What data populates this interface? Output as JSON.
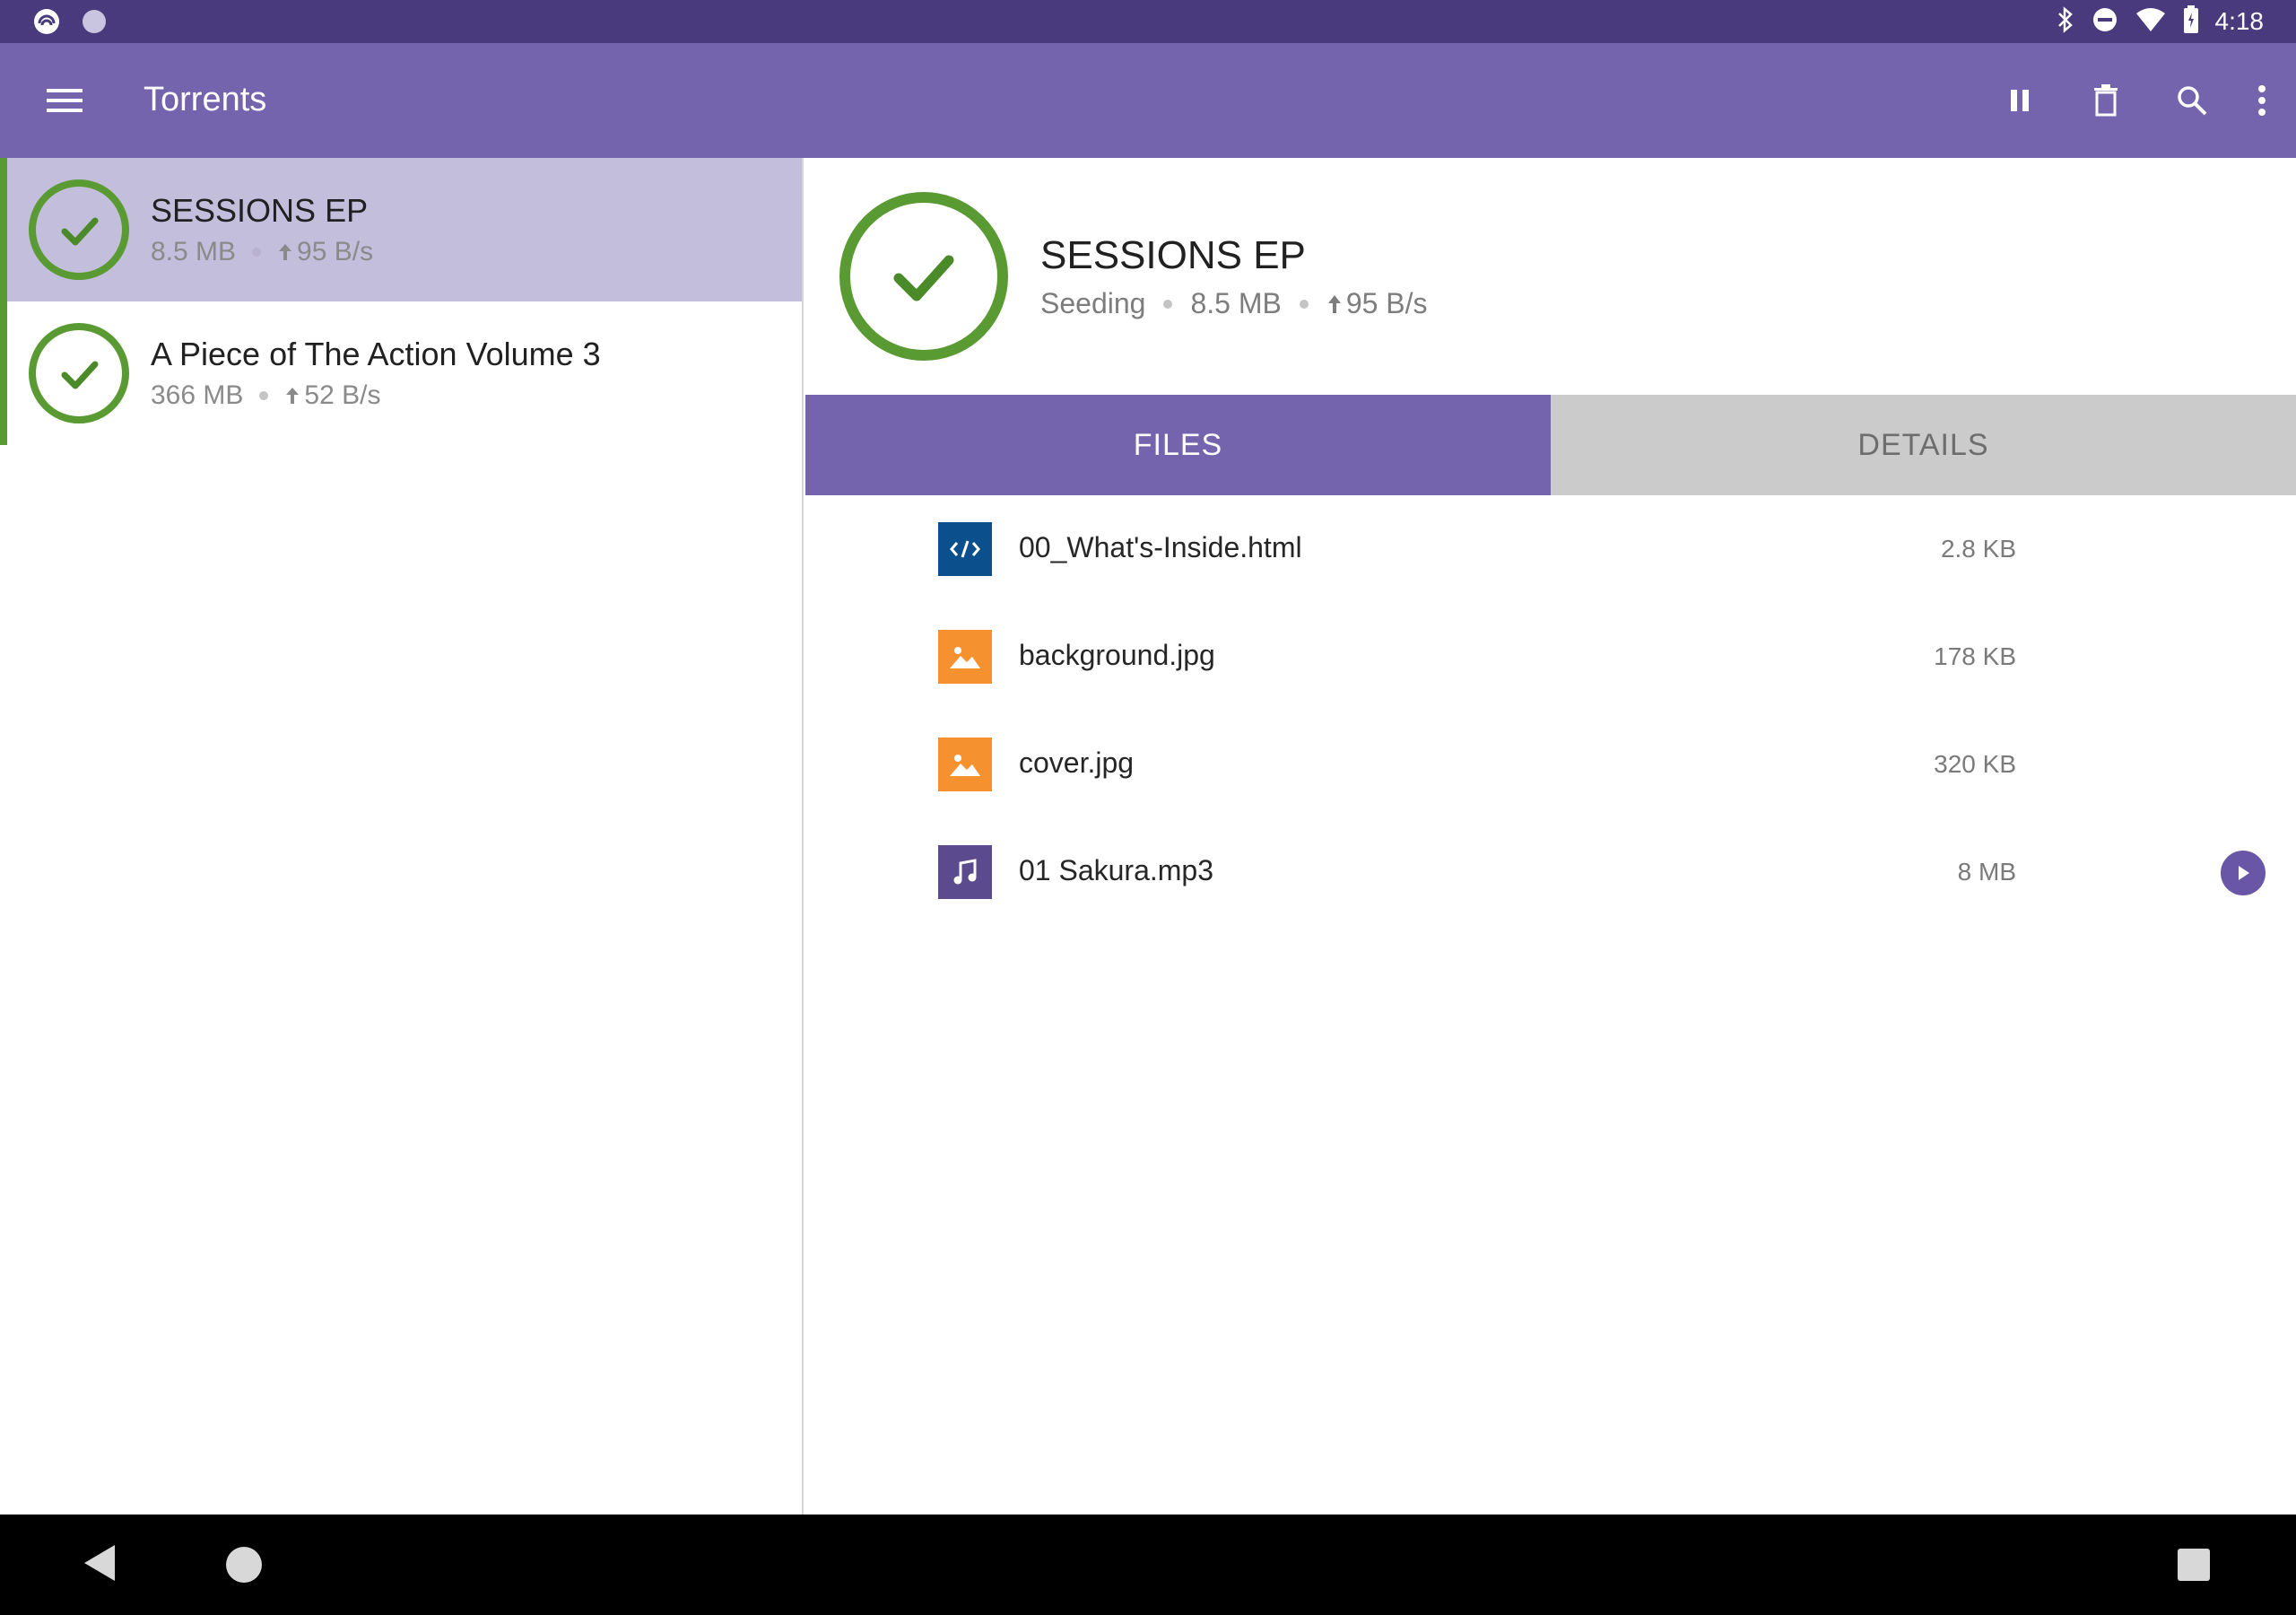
{
  "status_bar": {
    "time": "4:18",
    "left_icons": [
      "app-notification-icon",
      "circle-notification-icon"
    ],
    "right_icons": [
      "bluetooth-icon",
      "do-not-disturb-icon",
      "wifi-icon",
      "battery-icon"
    ]
  },
  "app_bar": {
    "title": "Torrents",
    "actions": [
      "pause-icon",
      "delete-icon",
      "search-icon",
      "more-vert-icon"
    ]
  },
  "torrents": [
    {
      "name": "SESSIONS EP",
      "size": "8.5 MB",
      "upload": "95 B/s",
      "selected": true
    },
    {
      "name": "A Piece of The Action Volume 3",
      "size": "366 MB",
      "upload": "52 B/s",
      "selected": false
    }
  ],
  "detail": {
    "name": "SESSIONS EP",
    "status": "Seeding",
    "size": "8.5 MB",
    "upload": "95 B/s",
    "progress": 1.0
  },
  "tabs": [
    {
      "label": "FILES",
      "active": true
    },
    {
      "label": "DETAILS",
      "active": false
    }
  ],
  "files": [
    {
      "name": "00_What's-Inside.html",
      "size": "2.8 KB",
      "icon": "html-code-icon"
    },
    {
      "name": "background.jpg",
      "size": "178 KB",
      "icon": "image-icon"
    },
    {
      "name": "cover.jpg",
      "size": "320 KB",
      "icon": "image-icon"
    },
    {
      "name": "01 Sakura.mp3",
      "size": "8 MB",
      "icon": "music-note-icon",
      "playable": true
    }
  ],
  "colors": {
    "status_bar": "#483a7c",
    "app_bar": "#7463ad",
    "selected_row": "#c4bedd",
    "complete_green": "#5a9a33",
    "html_icon": "#0b4f8c",
    "image_icon": "#f5922f",
    "audio_icon": "#5c4a8e"
  }
}
